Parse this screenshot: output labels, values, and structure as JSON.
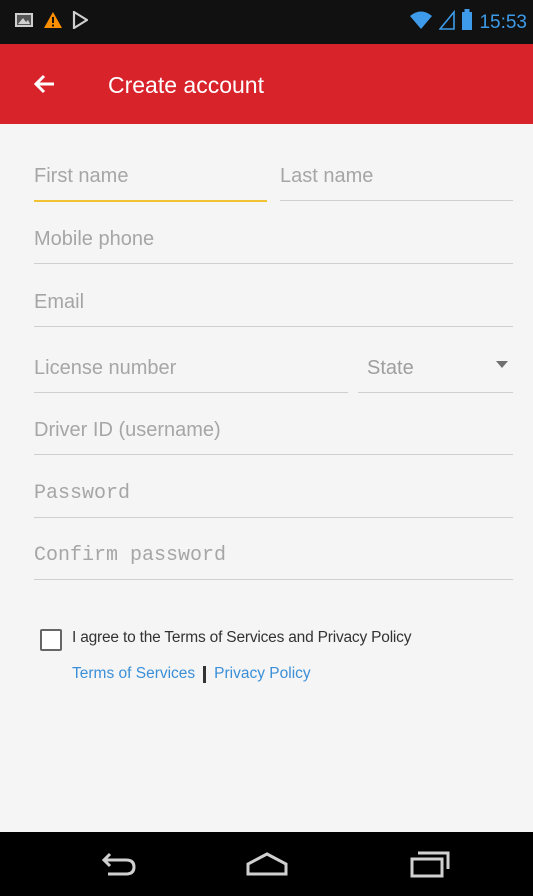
{
  "status_bar": {
    "time": "15:53",
    "left_icons": [
      "gallery-icon",
      "warning-icon",
      "play-store-icon"
    ],
    "right_icons": [
      "wifi-icon",
      "signal-icon",
      "battery-icon"
    ]
  },
  "app_bar": {
    "title": "Create account",
    "back_icon": "back-arrow-icon",
    "color": "#d9232b"
  },
  "form": {
    "first_name": {
      "placeholder": "First name",
      "value": ""
    },
    "last_name": {
      "placeholder": "Last name",
      "value": ""
    },
    "mobile_phone": {
      "placeholder": "Mobile phone",
      "value": ""
    },
    "email": {
      "placeholder": "Email",
      "value": ""
    },
    "license_number": {
      "placeholder": "License number",
      "value": ""
    },
    "state": {
      "selected": "State"
    },
    "driver_id": {
      "placeholder": "Driver ID (username)",
      "value": ""
    },
    "password": {
      "placeholder": "Password",
      "value": ""
    },
    "confirm_password": {
      "placeholder": "Confirm password",
      "value": ""
    },
    "agree": {
      "label": "I agree to the Terms of Services and Privacy Policy",
      "checked": false
    },
    "terms_link": "Terms of Services",
    "privacy_link": "Privacy Policy",
    "focus_color": "#f1c232",
    "link_color": "#3b8fd8"
  },
  "nav_bar": {
    "icons": [
      "back-nav-icon",
      "home-nav-icon",
      "recents-nav-icon"
    ]
  }
}
